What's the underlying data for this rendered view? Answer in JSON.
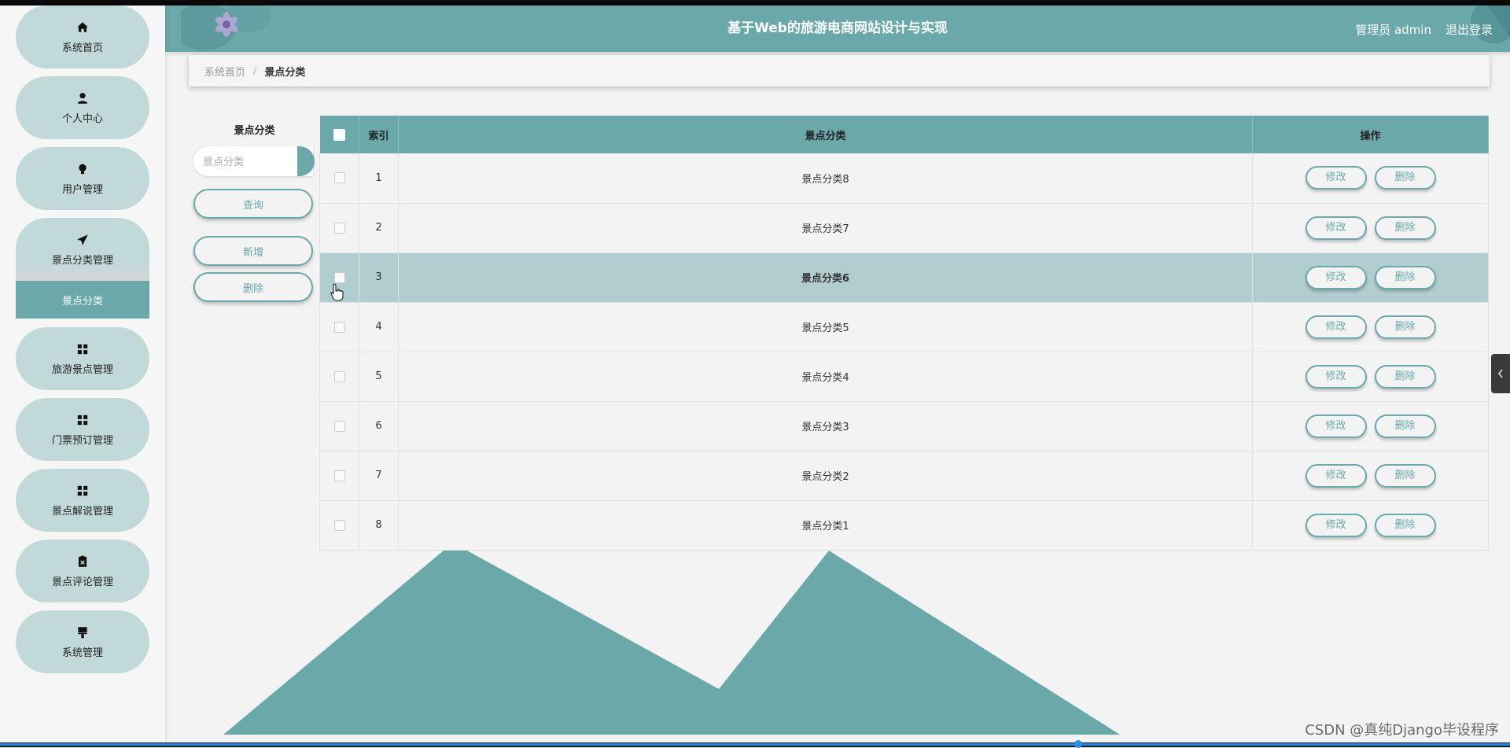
{
  "header": {
    "title": "基于Web的旅游电商网站设计与实现",
    "user": "管理员 admin",
    "logout": "退出登录"
  },
  "sidebar": {
    "items": [
      {
        "label": "系统首页",
        "icon": "home-icon"
      },
      {
        "label": "个人中心",
        "icon": "user-icon"
      },
      {
        "label": "用户管理",
        "icon": "bulb-icon"
      },
      {
        "label": "景点分类管理",
        "icon": "paper-plane-icon"
      },
      {
        "label": "旅游景点管理",
        "icon": "grid-icon"
      },
      {
        "label": "门票预订管理",
        "icon": "grid-icon"
      },
      {
        "label": "景点解说管理",
        "icon": "grid-icon"
      },
      {
        "label": "景点评论管理",
        "icon": "clipboard-icon"
      },
      {
        "label": "系统管理",
        "icon": "brush-icon"
      }
    ],
    "sub_item": "景点分类"
  },
  "breadcrumb": {
    "home": "系统首页",
    "separator": "/",
    "current": "景点分类"
  },
  "search": {
    "label": "景点分类",
    "placeholder": "景点分类",
    "query_button": "查询",
    "add_button": "新增",
    "delete_button": "删除"
  },
  "table": {
    "headers": {
      "index": "索引",
      "name": "景点分类",
      "actions": "操作"
    },
    "edit_label": "修改",
    "delete_label": "删除",
    "rows": [
      {
        "index": "1",
        "name": "景点分类8"
      },
      {
        "index": "2",
        "name": "景点分类7"
      },
      {
        "index": "3",
        "name": "景点分类6"
      },
      {
        "index": "4",
        "name": "景点分类5"
      },
      {
        "index": "5",
        "name": "景点分类4"
      },
      {
        "index": "6",
        "name": "景点分类3"
      },
      {
        "index": "7",
        "name": "景点分类2"
      },
      {
        "index": "8",
        "name": "景点分类1"
      }
    ],
    "highlighted_row": 3
  },
  "watermark": "CSDN @真纯Django毕设程序",
  "colors": {
    "accent": "#6aa8aa",
    "nav_bg": "#c2d9d9",
    "row_highlight": "#b1cdd0"
  }
}
